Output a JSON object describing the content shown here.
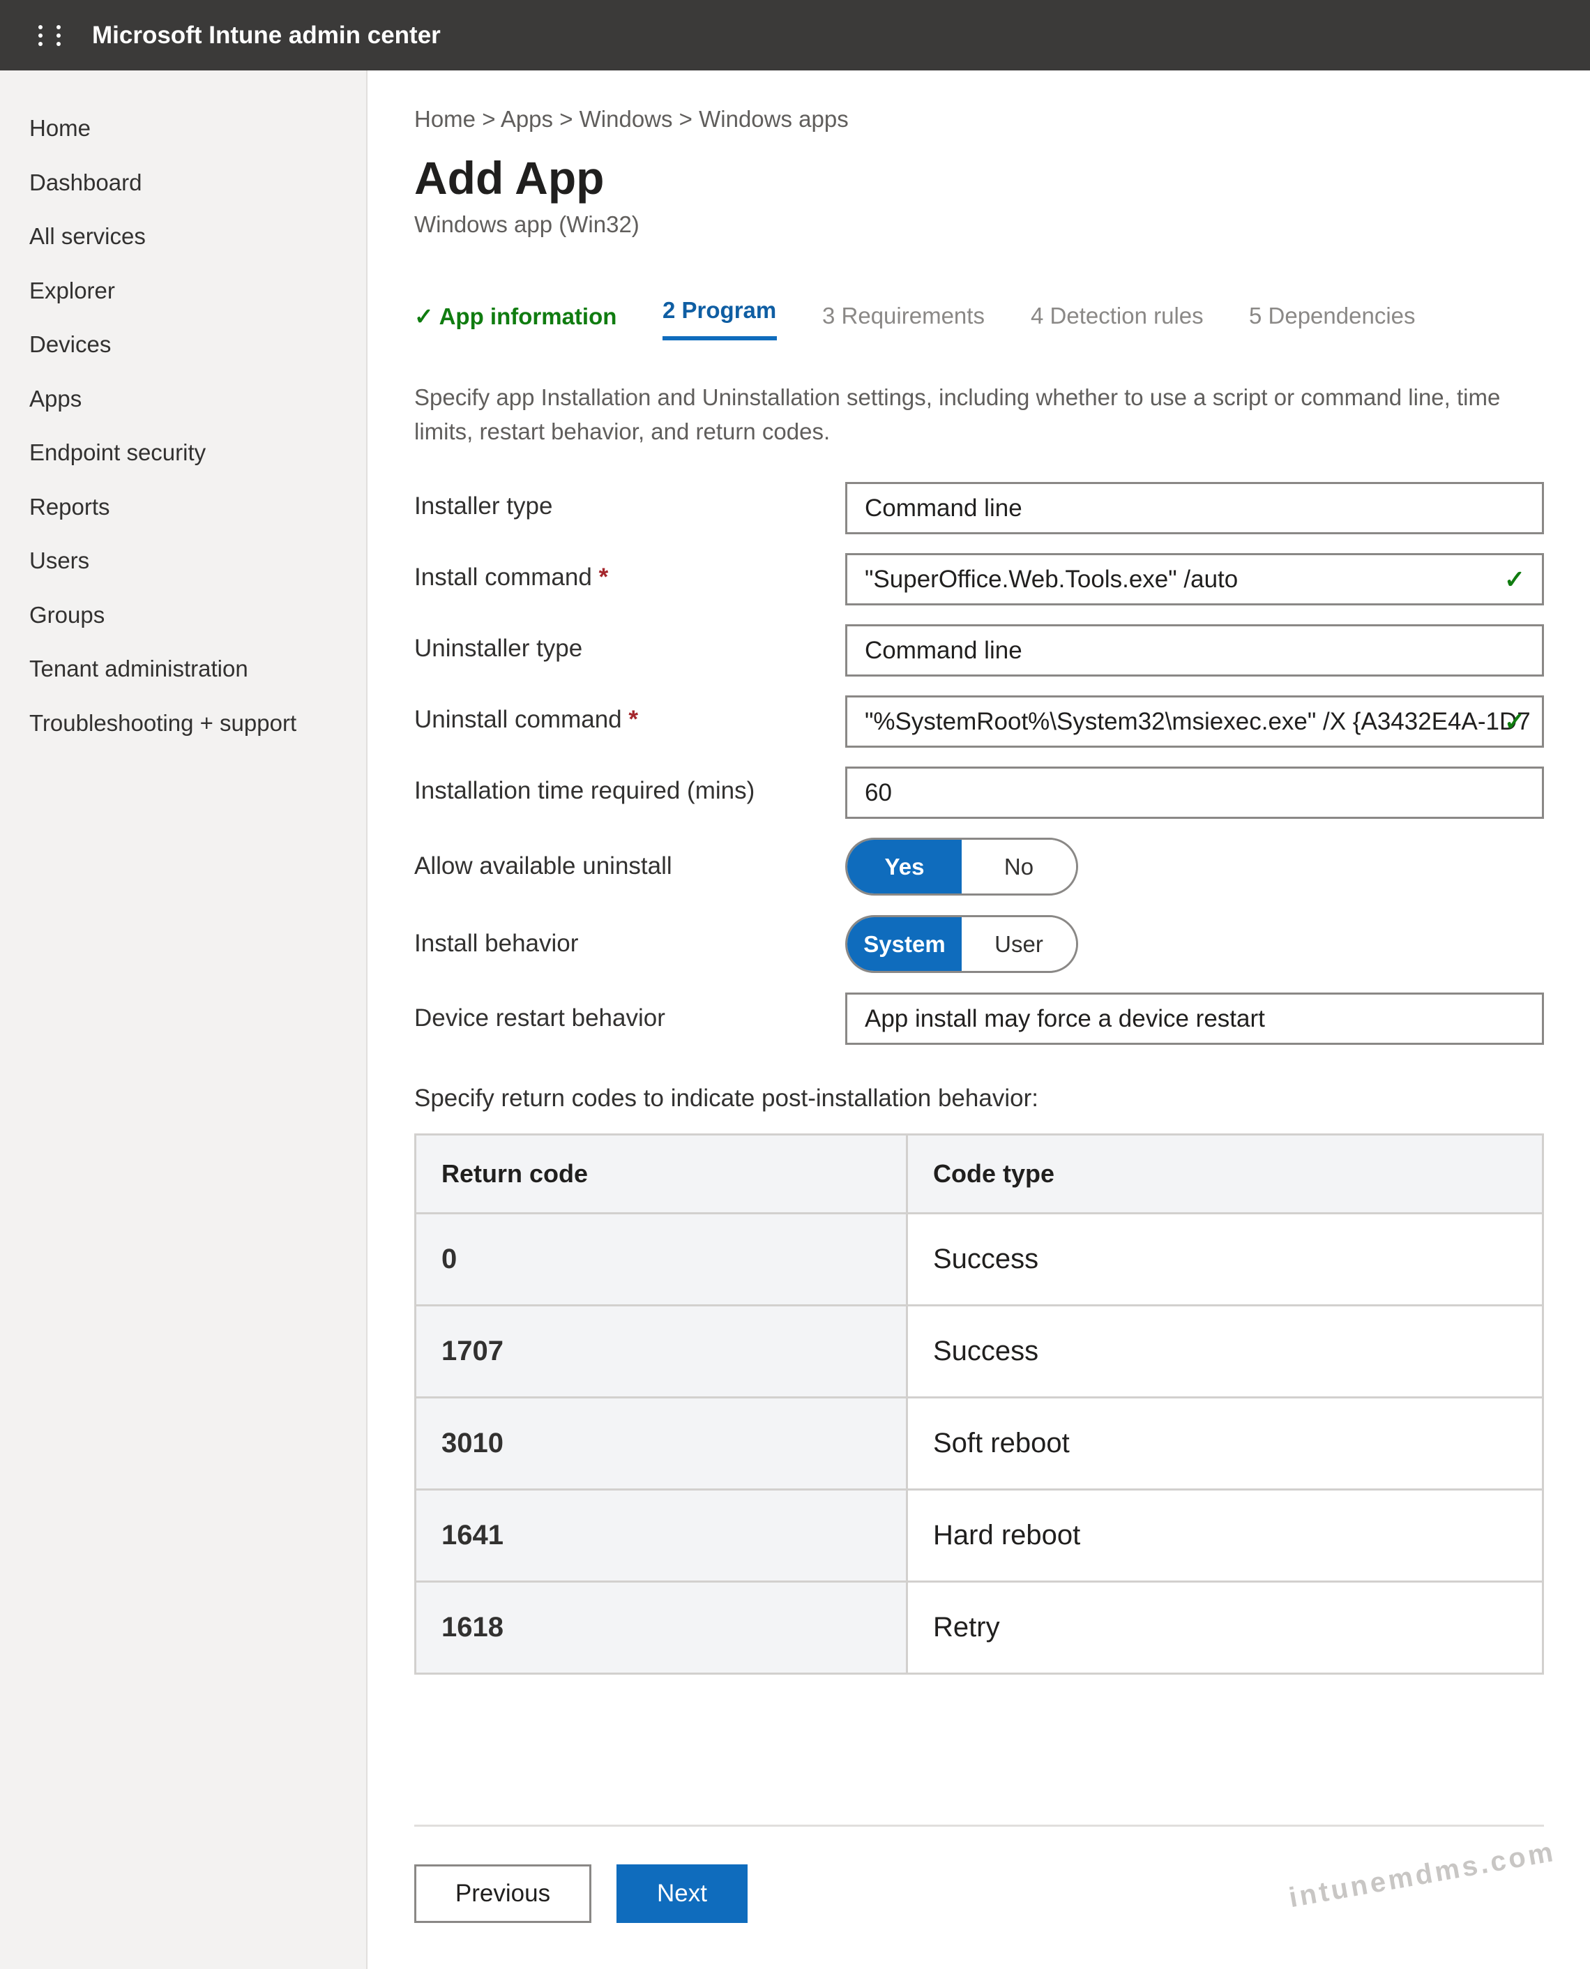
{
  "topbar": {
    "title": "Microsoft Intune admin center"
  },
  "sidebar": {
    "items": [
      {
        "label": "Home"
      },
      {
        "label": "Dashboard"
      },
      {
        "label": "All services"
      },
      {
        "label": "Explorer"
      },
      {
        "label": "Devices"
      },
      {
        "label": "Apps"
      },
      {
        "label": "Endpoint security"
      },
      {
        "label": "Reports"
      },
      {
        "label": "Users"
      },
      {
        "label": "Groups"
      },
      {
        "label": "Tenant administration"
      },
      {
        "label": "Troubleshooting + support"
      }
    ]
  },
  "breadcrumb": "Home > Apps > Windows > Windows apps",
  "page": {
    "title": "Add App",
    "subtitle": "Windows app (Win32)"
  },
  "tabs": [
    {
      "label": "✓ App information",
      "state": "done"
    },
    {
      "label": "2 Program",
      "state": "active"
    },
    {
      "label": "3 Requirements",
      "state": "pending"
    },
    {
      "label": "4 Detection rules",
      "state": "pending"
    },
    {
      "label": "5 Dependencies",
      "state": "pending"
    }
  ],
  "description": "Specify app Installation and Uninstallation settings, including whether to use a script or command line, time limits, restart behavior, and return codes.",
  "form": {
    "installer_type": {
      "label": "Installer type",
      "value": "Command line"
    },
    "install_command": {
      "label": "Install command",
      "required": "*",
      "value": "\"SuperOffice.Web.Tools.exe\" /auto",
      "check": "✓"
    },
    "uninstaller_type": {
      "label": "Uninstaller type",
      "value": "Command line"
    },
    "uninstall_command": {
      "label": "Uninstall command",
      "required": "*",
      "value": "\"%SystemRoot%\\System32\\msiexec.exe\" /X {A3432E4A-1D7",
      "check": "✓"
    },
    "install_time": {
      "label": "Installation time required (mins)",
      "value": "60"
    },
    "allow_uninstall": {
      "label": "Allow available uninstall",
      "on": "Yes",
      "off": "No"
    },
    "install_behavior": {
      "label": "Install behavior",
      "on": "System",
      "off": "User"
    },
    "restart_behavior": {
      "label": "Device restart behavior",
      "value": "App install may force a device restart"
    }
  },
  "return_codes": {
    "intro": "Specify return codes to indicate post-installation behavior:",
    "headers": {
      "code": "Return code",
      "type": "Code type"
    },
    "rows": [
      {
        "code": "0",
        "type": "Success"
      },
      {
        "code": "1707",
        "type": "Success"
      },
      {
        "code": "3010",
        "type": "Soft reboot"
      },
      {
        "code": "1641",
        "type": "Hard reboot"
      },
      {
        "code": "1618",
        "type": "Retry"
      }
    ]
  },
  "buttons": {
    "previous": "Previous",
    "next": "Next"
  },
  "watermark": "intunemdms.com",
  "colors": {
    "accent": "#0f6cbd",
    "success": "#107c10",
    "required": "#a4262c",
    "topbar": "#3b3a39"
  }
}
